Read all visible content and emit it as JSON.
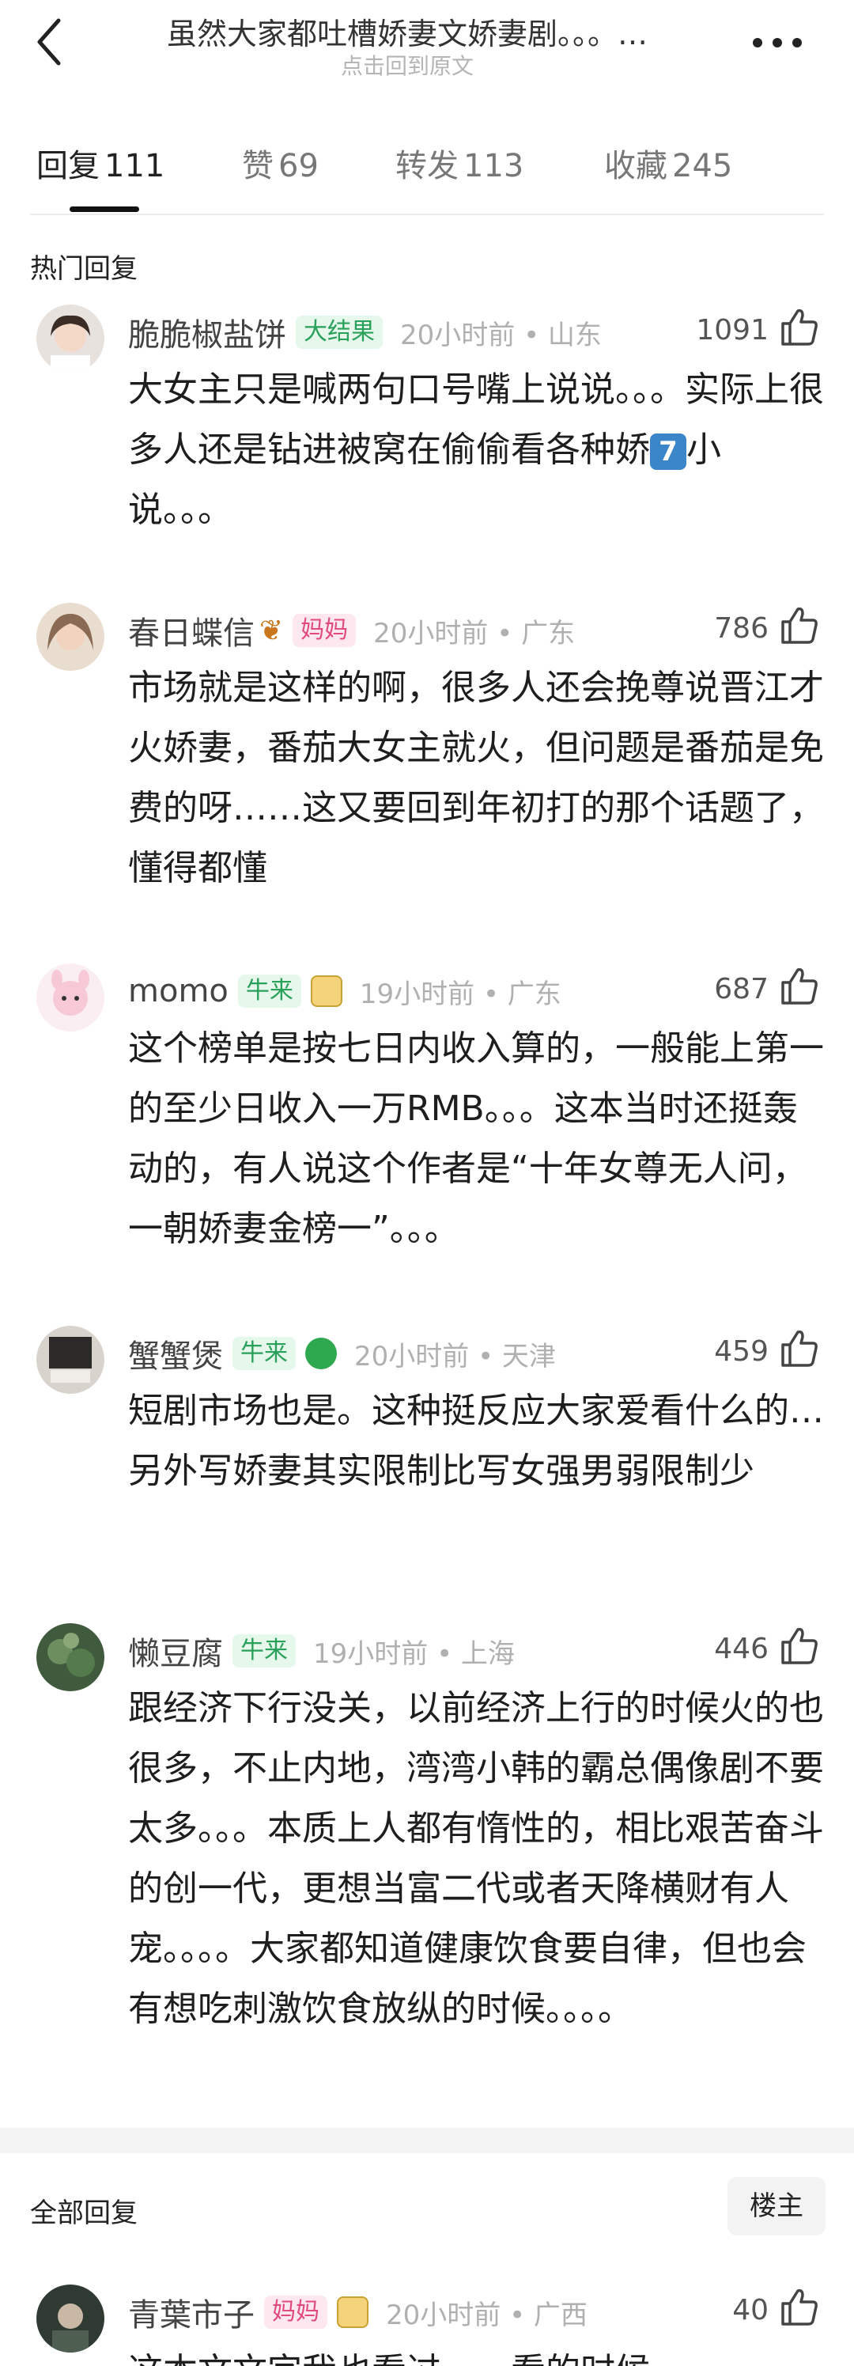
{
  "header": {
    "title": "虽然大家都吐槽娇妻文娇妻剧。。。…",
    "subtitle": "点击回到原文"
  },
  "tabs": [
    {
      "label": "回复",
      "count": "111"
    },
    {
      "label": "赞",
      "count": "69"
    },
    {
      "label": "转发",
      "count": "113"
    },
    {
      "label": "收藏",
      "count": "245"
    }
  ],
  "hot_label": "热门回复",
  "all_label": "全部回复",
  "louzhu_label": "楼主",
  "comments": [
    {
      "name": "脆脆椒盐饼",
      "badge": "大结果",
      "time": "20小时前 • 山东",
      "likes": "1091",
      "text_a": "大女主只是喊两句口号嘴上说说。。。实际上很多人还是钻进被窝在偷偷看各种娇",
      "text_num": "7",
      "text_b": "小说。。。"
    },
    {
      "name": "春日蝶信",
      "badge": "妈妈",
      "time": "20小时前 • 广东",
      "likes": "786",
      "text": "市场就是这样的啊，很多人还会挽尊说晋江才火娇妻，番茄大女主就火，但问题是番茄是免费的呀……这又要回到年初打的那个话题了，懂得都懂"
    },
    {
      "name": "momo",
      "badge": "牛来",
      "time": "19小时前 • 广东",
      "likes": "687",
      "text": "这个榜单是按七日内收入算的，一般能上第一的至少日收入一万RMB。。。这本当时还挺轰动的，有人说这个作者是“十年女尊无人问，一朝娇妻金榜一”。。。"
    },
    {
      "name": "蟹蟹煲",
      "badge": "牛来",
      "time": "20小时前 • 天津",
      "likes": "459",
      "text": "短剧市场也是。这种挺反应大家爱看什么的…另外写娇妻其实限制比写女强男弱限制少"
    },
    {
      "name": "懒豆腐",
      "badge": "牛来",
      "time": "19小时前 • 上海",
      "likes": "446",
      "text": "跟经济下行没关，以前经济上行的时候火的也很多，不止内地，湾湾小韩的霸总偶像剧不要太多。。。本质上人都有惰性的，相比艰苦奋斗的创一代，更想当富二代或者天降横财有人宠。。。。大家都知道健康饮食要自律，但也会有想吃刺激饮食放纵的时候。。。。"
    },
    {
      "name": "青葉市子",
      "badge": "妈妈",
      "time": "20小时前 • 广西",
      "likes": "40",
      "text": "这本文文字我也看过……看的时候"
    }
  ]
}
